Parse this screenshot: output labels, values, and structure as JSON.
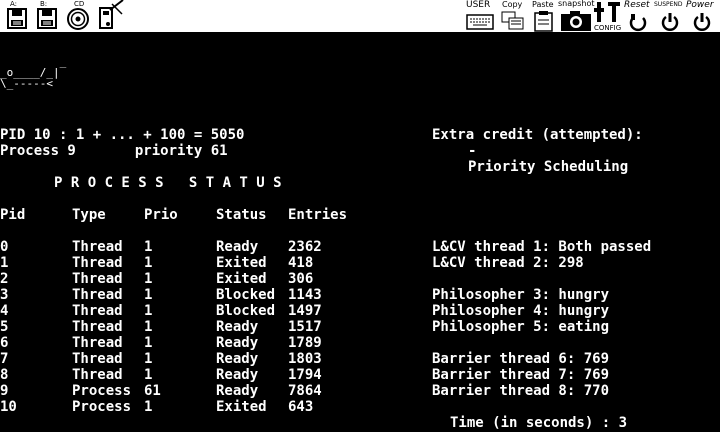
{
  "toolbar": {
    "drive_a": "A:",
    "drive_b": "B:",
    "drive_cd": "CD",
    "user": "USER",
    "copy": "Copy",
    "paste": "Paste",
    "snapshot": "snapshot",
    "config": "CONFIG",
    "reset": "Reset",
    "suspend": "SUSPEND",
    "power": "Power"
  },
  "logo_ascii": [
    "         _",
    "_o____/_|",
    "\\_-----<"
  ],
  "header": {
    "sum_line": "PID 10 : 1 + ... + 100 = 5050",
    "priority_line": "Process 9       priority 61"
  },
  "status_title": "P R O C E S S   S T A T U S",
  "columns": [
    "Pid",
    "Type",
    "Prio",
    "Status",
    "Entries"
  ],
  "processes": [
    {
      "pid": "0",
      "type": "Thread",
      "prio": "1",
      "status": "Ready",
      "entries": "2362"
    },
    {
      "pid": "1",
      "type": "Thread",
      "prio": "1",
      "status": "Exited",
      "entries": "418"
    },
    {
      "pid": "2",
      "type": "Thread",
      "prio": "1",
      "status": "Exited",
      "entries": "306"
    },
    {
      "pid": "3",
      "type": "Thread",
      "prio": "1",
      "status": "Blocked",
      "entries": "1143"
    },
    {
      "pid": "4",
      "type": "Thread",
      "prio": "1",
      "status": "Blocked",
      "entries": "1497"
    },
    {
      "pid": "5",
      "type": "Thread",
      "prio": "1",
      "status": "Ready",
      "entries": "1517"
    },
    {
      "pid": "6",
      "type": "Thread",
      "prio": "1",
      "status": "Ready",
      "entries": "1789"
    },
    {
      "pid": "7",
      "type": "Thread",
      "prio": "1",
      "status": "Ready",
      "entries": "1803"
    },
    {
      "pid": "8",
      "type": "Thread",
      "prio": "1",
      "status": "Ready",
      "entries": "1794"
    },
    {
      "pid": "9",
      "type": "Process",
      "prio": "61",
      "status": "Ready",
      "entries": "7864"
    },
    {
      "pid": "10",
      "type": "Process",
      "prio": "1",
      "status": "Exited",
      "entries": "643"
    }
  ],
  "extra": {
    "title": "Extra credit (attempted):",
    "dash": "-",
    "item": "Priority Scheduling"
  },
  "right_lines": [
    "L&CV thread 1: Both passed",
    "L&CV thread 2: 298",
    "",
    "Philosopher 3: hungry",
    "Philosopher 4: hungry",
    "Philosopher 5: eating",
    "",
    "Barrier thread 6: 769",
    "Barrier thread 7: 769",
    "Barrier thread 8: 770"
  ],
  "time_line": "Time (in seconds) : 3"
}
